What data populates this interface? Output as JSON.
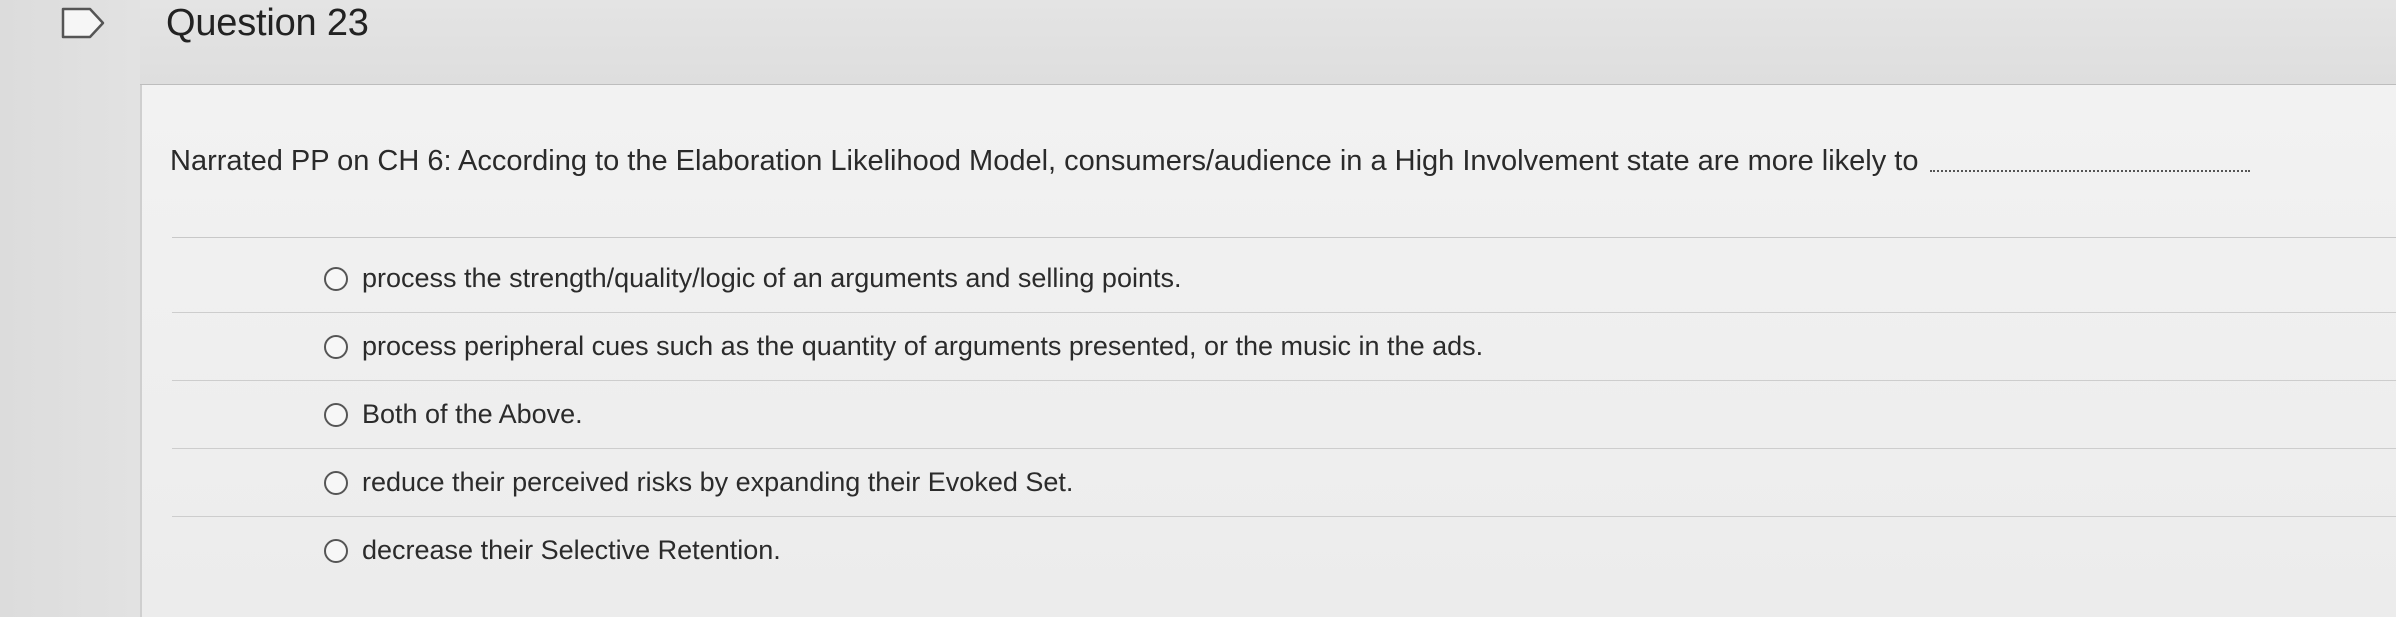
{
  "question": {
    "title": "Question 23",
    "text": "Narrated PP on CH 6:  According to the Elaboration Likelihood Model, consumers/audience in a High Involvement state are more likely to",
    "options": [
      "process the strength/quality/logic of an arguments and selling points.",
      "process peripheral cues such as the quantity of arguments presented, or the music in the ads.",
      "Both of the Above.",
      "reduce their perceived risks by expanding their Evoked Set.",
      "decrease their Selective Retention."
    ]
  },
  "colors": {
    "background": "#e6e6e6",
    "content": "#f0f0f0",
    "text": "#2b2b2b"
  }
}
